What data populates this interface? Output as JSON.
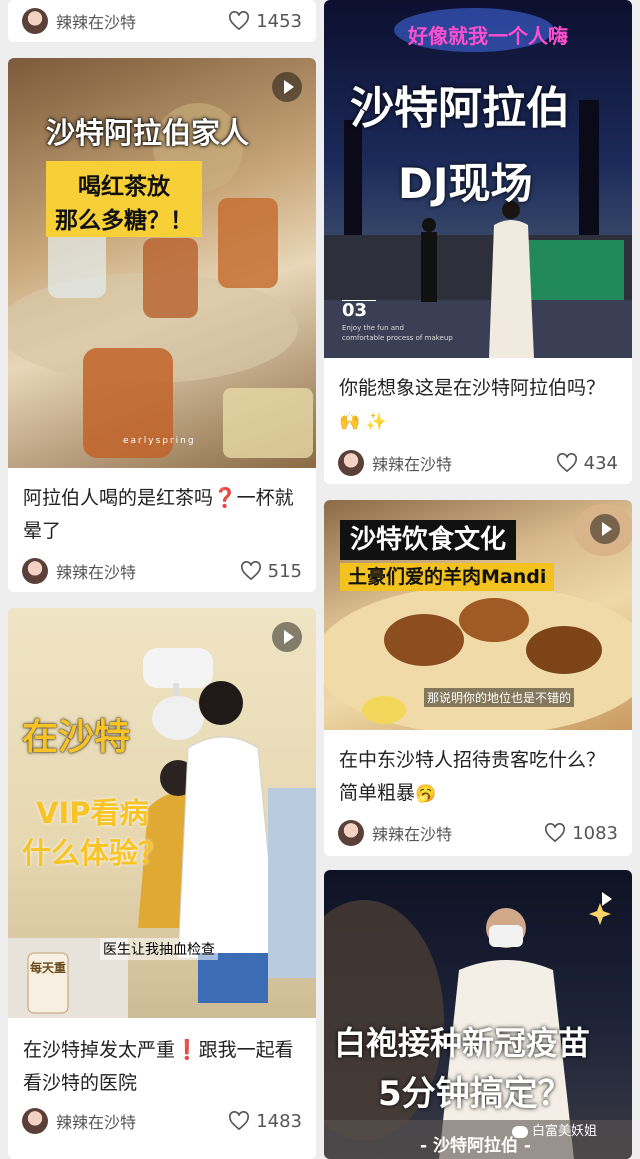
{
  "cards": [
    {
      "author": "辣辣在沙特",
      "likes": "1453"
    },
    {
      "title": "阿拉伯人喝的是红茶吗❓一杯就晕了",
      "author": "辣辣在沙特",
      "likes": "515",
      "overlay": {
        "headline": "沙特阿拉伯家人",
        "line1": "喝红茶放",
        "line2": "那么多糖？！",
        "watermark": "earlyspring"
      }
    },
    {
      "title": "在沙特掉发太严重❗️跟我一起看看沙特的医院",
      "author": "辣辣在沙特",
      "likes": "1483",
      "overlay": {
        "headline": "在沙特",
        "line1": "VIP看病",
        "line2": "什么体验？",
        "caption": "医生让我抽血检查",
        "sign": "每天重"
      }
    },
    {
      "title_text": "你能想象这是在沙特阿拉伯吗？",
      "title_emoji": "🙌 ✨",
      "author": "辣辣在沙特",
      "likes": "434",
      "overlay": {
        "top": "好像就我一个人嗨",
        "headline": "沙特阿拉伯",
        "sub": "DJ现场",
        "number": "03",
        "small1": "Enjoy the fun and",
        "small2": "comfortable process of makeup"
      }
    },
    {
      "title_text": "在中东沙特人招待贵客吃什么？简单粗暴",
      "title_emoji": "🥱",
      "author": "辣辣在沙特",
      "likes": "1083",
      "overlay": {
        "headline": "沙特饮食文化",
        "sub": "土豪们爱的羊肉Mandi",
        "caption": "那说明你的地位也是不错的"
      }
    },
    {
      "overlay": {
        "headline": "白袍接种新冠疫苗",
        "sub": "5分钟搞定？",
        "footer": "- 沙特阿拉伯 -",
        "watermark": "白富美妖姐"
      }
    }
  ]
}
